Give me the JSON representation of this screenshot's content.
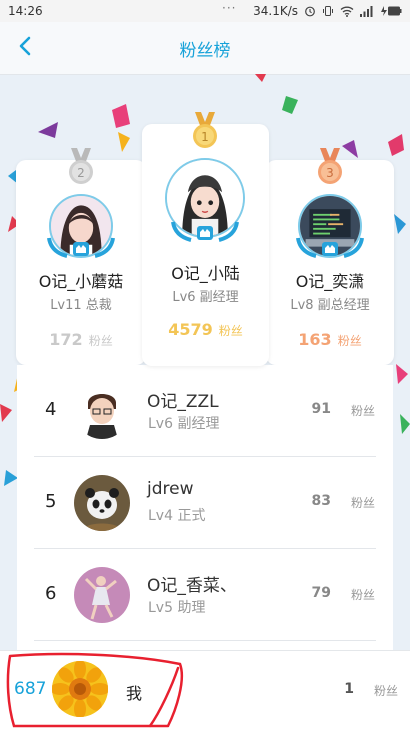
{
  "status_bar": {
    "time": "14:26",
    "speed": "34.1K/s"
  },
  "nav": {
    "title": "粉丝榜"
  },
  "podium": {
    "first": {
      "rank": "1",
      "name": "O记_小陆",
      "level": "Lv6 副经理",
      "fans": "4579",
      "fans_label": "粉丝",
      "color": "#f3c556"
    },
    "second": {
      "rank": "2",
      "name": "O记_小蘑菇",
      "level": "Lv11 总裁",
      "fans": "172",
      "fans_label": "粉丝",
      "color": "#c9c9c9"
    },
    "third": {
      "rank": "3",
      "name": "O记_奕潇",
      "level": "Lv8 副总经理",
      "fans": "163",
      "fans_label": "粉丝",
      "color": "#f4a374"
    }
  },
  "list": [
    {
      "rank": "4",
      "name": "O记_ZZL",
      "level": "Lv6 副经理",
      "fans": "91",
      "fans_label": "粉丝"
    },
    {
      "rank": "5",
      "name": "jdrew",
      "level": "Lv4 正式",
      "fans": "83",
      "fans_label": "粉丝"
    },
    {
      "rank": "6",
      "name": "O记_香菜、",
      "level": "Lv5 助理",
      "fans": "79",
      "fans_label": "粉丝"
    }
  ],
  "me": {
    "rank": "687",
    "name": "我",
    "fans": "1",
    "fans_label": "粉丝"
  },
  "colors": {
    "accent": "#17a2d9",
    "annotation": "#e8202f"
  }
}
